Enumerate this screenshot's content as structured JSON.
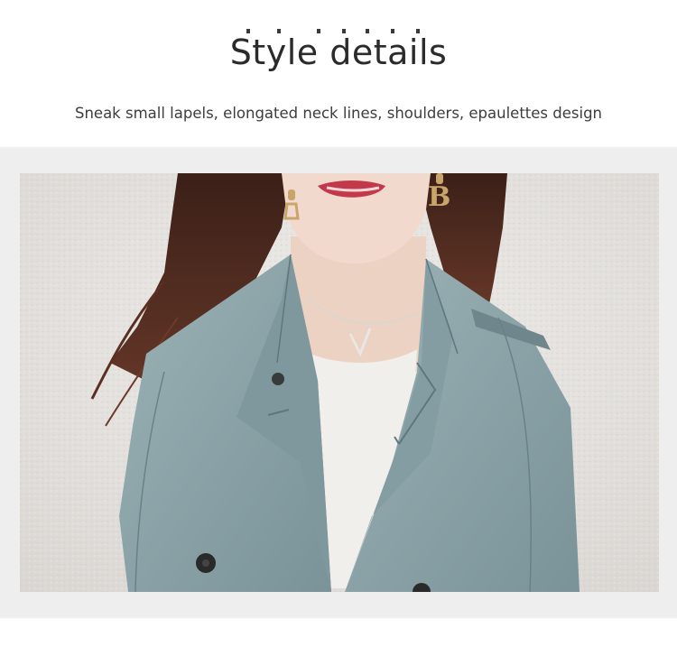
{
  "header": {
    "title": "Style details",
    "subtitle": "Sneak small lapels, elongated neck lines, shoulders, epaulettes design"
  },
  "colors": {
    "background": "#ffffff",
    "band": "#eeeeee",
    "wall": "#e4e2df",
    "coat": "#8fa7ac",
    "coat_shadow": "#6f878c",
    "hair": "#4a2a20",
    "skin": "#efd6c8",
    "inner_top": "#f1efec",
    "lips": "#c23a4a"
  },
  "photo": {
    "icon": "model-trench-coat-photo"
  }
}
